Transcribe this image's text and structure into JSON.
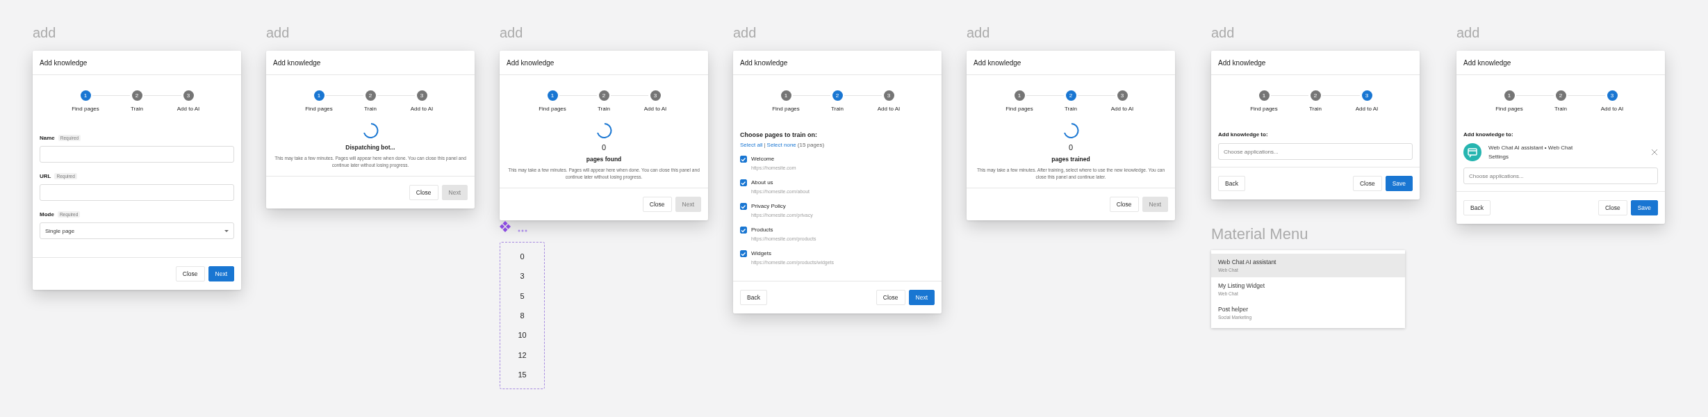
{
  "frames": [
    {
      "label": "add",
      "dialog": {
        "title": "Add knowledge",
        "steps": [
          {
            "number": "1",
            "label": "Find pages",
            "selected": true
          },
          {
            "number": "2",
            "label": "Train",
            "selected": false
          },
          {
            "number": "3",
            "label": "Add to AI",
            "selected": false
          }
        ],
        "body": {
          "kind": "form",
          "fields": [
            {
              "kind": "text",
              "label": "Name",
              "badge": "Required"
            },
            {
              "kind": "text",
              "label": "URL",
              "badge": "Required"
            },
            {
              "kind": "select",
              "label": "Mode",
              "badge": "Required",
              "value": "Single page"
            }
          ]
        },
        "buttons": [
          {
            "label": "Close",
            "kind": "secondary",
            "disabled": false
          },
          {
            "label": "Next",
            "kind": "primary",
            "disabled": false
          }
        ]
      }
    },
    {
      "label": "add",
      "dialog": {
        "title": "Add knowledge",
        "steps": [
          {
            "number": "1",
            "label": "Find pages",
            "selected": true
          },
          {
            "number": "2",
            "label": "Train",
            "selected": false
          },
          {
            "number": "3",
            "label": "Add to AI",
            "selected": false
          }
        ],
        "body": {
          "kind": "progress",
          "title": "Dispatching bot...",
          "message": "This may take a few minutes. Pages will appear here when done. You can close this panel and continue later without losing progress."
        },
        "buttons": [
          {
            "label": "Close",
            "kind": "secondary",
            "disabled": false
          },
          {
            "label": "Next",
            "kind": "primary",
            "disabled": true
          }
        ]
      }
    },
    {
      "label": "add",
      "dialog": {
        "title": "Add knowledge",
        "steps": [
          {
            "number": "1",
            "label": "Find pages",
            "selected": true
          },
          {
            "number": "2",
            "label": "Train",
            "selected": false
          },
          {
            "number": "3",
            "label": "Add to AI",
            "selected": false
          }
        ],
        "body": {
          "kind": "progress",
          "count": "0",
          "title": "pages found",
          "message": "This may take a few minutes. Pages will appear here when done. You can close this panel and continue later without losing progress."
        },
        "buttons": [
          {
            "label": "Close",
            "kind": "secondary",
            "disabled": false
          },
          {
            "label": "Next",
            "kind": "primary",
            "disabled": true
          }
        ]
      },
      "number_list": [
        "0",
        "3",
        "5",
        "8",
        "10",
        "12",
        "15"
      ]
    },
    {
      "label": "add",
      "dialog": {
        "title": "Add knowledge",
        "steps": [
          {
            "number": "1",
            "label": "Find pages",
            "selected": false
          },
          {
            "number": "2",
            "label": "Train",
            "selected": true
          },
          {
            "number": "3",
            "label": "Add to AI",
            "selected": false
          }
        ],
        "body": {
          "kind": "pages",
          "heading": "Choose pages to train on:",
          "select_all": "Select all",
          "separator": "|",
          "select_none": "Select none",
          "count": "(15 pages)",
          "pages": [
            {
              "title": "Welcome",
              "url": "https://homesite.com",
              "checked": true
            },
            {
              "title": "About us",
              "url": "https://homesite.com/about",
              "checked": true
            },
            {
              "title": "Privacy Policy",
              "url": "https://homesite.com/privacy",
              "checked": true
            },
            {
              "title": "Products",
              "url": "https://homesite.com/products",
              "checked": true
            },
            {
              "title": "Widgets",
              "url": "https://homesite.com/products/widgets",
              "checked": true
            }
          ]
        },
        "back_button": "Back",
        "buttons": [
          {
            "label": "Close",
            "kind": "secondary",
            "disabled": false
          },
          {
            "label": "Next",
            "kind": "primary",
            "disabled": false
          }
        ]
      }
    },
    {
      "label": "add",
      "dialog": {
        "title": "Add knowledge",
        "steps": [
          {
            "number": "1",
            "label": "Find pages",
            "selected": false
          },
          {
            "number": "2",
            "label": "Train",
            "selected": true
          },
          {
            "number": "3",
            "label": "Add to AI",
            "selected": false
          }
        ],
        "body": {
          "kind": "progress",
          "count": "0",
          "title": "pages trained",
          "message": "This may take a few minutes. After training, select where to use the new knowledge. You can close this panel and continue later."
        },
        "buttons": [
          {
            "label": "Close",
            "kind": "secondary",
            "disabled": false
          },
          {
            "label": "Next",
            "kind": "primary",
            "disabled": true
          }
        ]
      }
    },
    {
      "label": "add",
      "dialog": {
        "title": "Add knowledge",
        "steps": [
          {
            "number": "1",
            "label": "Find pages",
            "selected": false
          },
          {
            "number": "2",
            "label": "Train",
            "selected": false
          },
          {
            "number": "3",
            "label": "Add to AI",
            "selected": true
          }
        ],
        "body": {
          "kind": "apps",
          "heading": "Add knowledge to:",
          "placeholder": "Choose applications..."
        },
        "back_button": "Back",
        "buttons": [
          {
            "label": "Close",
            "kind": "secondary",
            "disabled": false
          },
          {
            "label": "Save",
            "kind": "primary",
            "disabled": false
          }
        ]
      },
      "menu": {
        "label": "Material Menu",
        "items": [
          {
            "title": "Web Chat AI assistant",
            "subtitle": "Web Chat",
            "selected": true
          },
          {
            "title": "My Listing Widget",
            "subtitle": "Web Chat",
            "selected": false
          },
          {
            "title": "Post helper",
            "subtitle": "Social Marketing",
            "selected": false
          }
        ]
      }
    },
    {
      "label": "add",
      "dialog": {
        "title": "Add knowledge",
        "steps": [
          {
            "number": "1",
            "label": "Find pages",
            "selected": false
          },
          {
            "number": "2",
            "label": "Train",
            "selected": false
          },
          {
            "number": "3",
            "label": "Add to AI",
            "selected": true
          }
        ],
        "body": {
          "kind": "apps",
          "heading": "Add knowledge to:",
          "apps": [
            {
              "name": "Web Chat AI assistant • Web Chat",
              "link": "Settings"
            }
          ],
          "placeholder": "Choose applications..."
        },
        "back_button": "Back",
        "buttons": [
          {
            "label": "Close",
            "kind": "secondary",
            "disabled": false
          },
          {
            "label": "Save",
            "kind": "primary",
            "disabled": false
          }
        ]
      }
    }
  ]
}
